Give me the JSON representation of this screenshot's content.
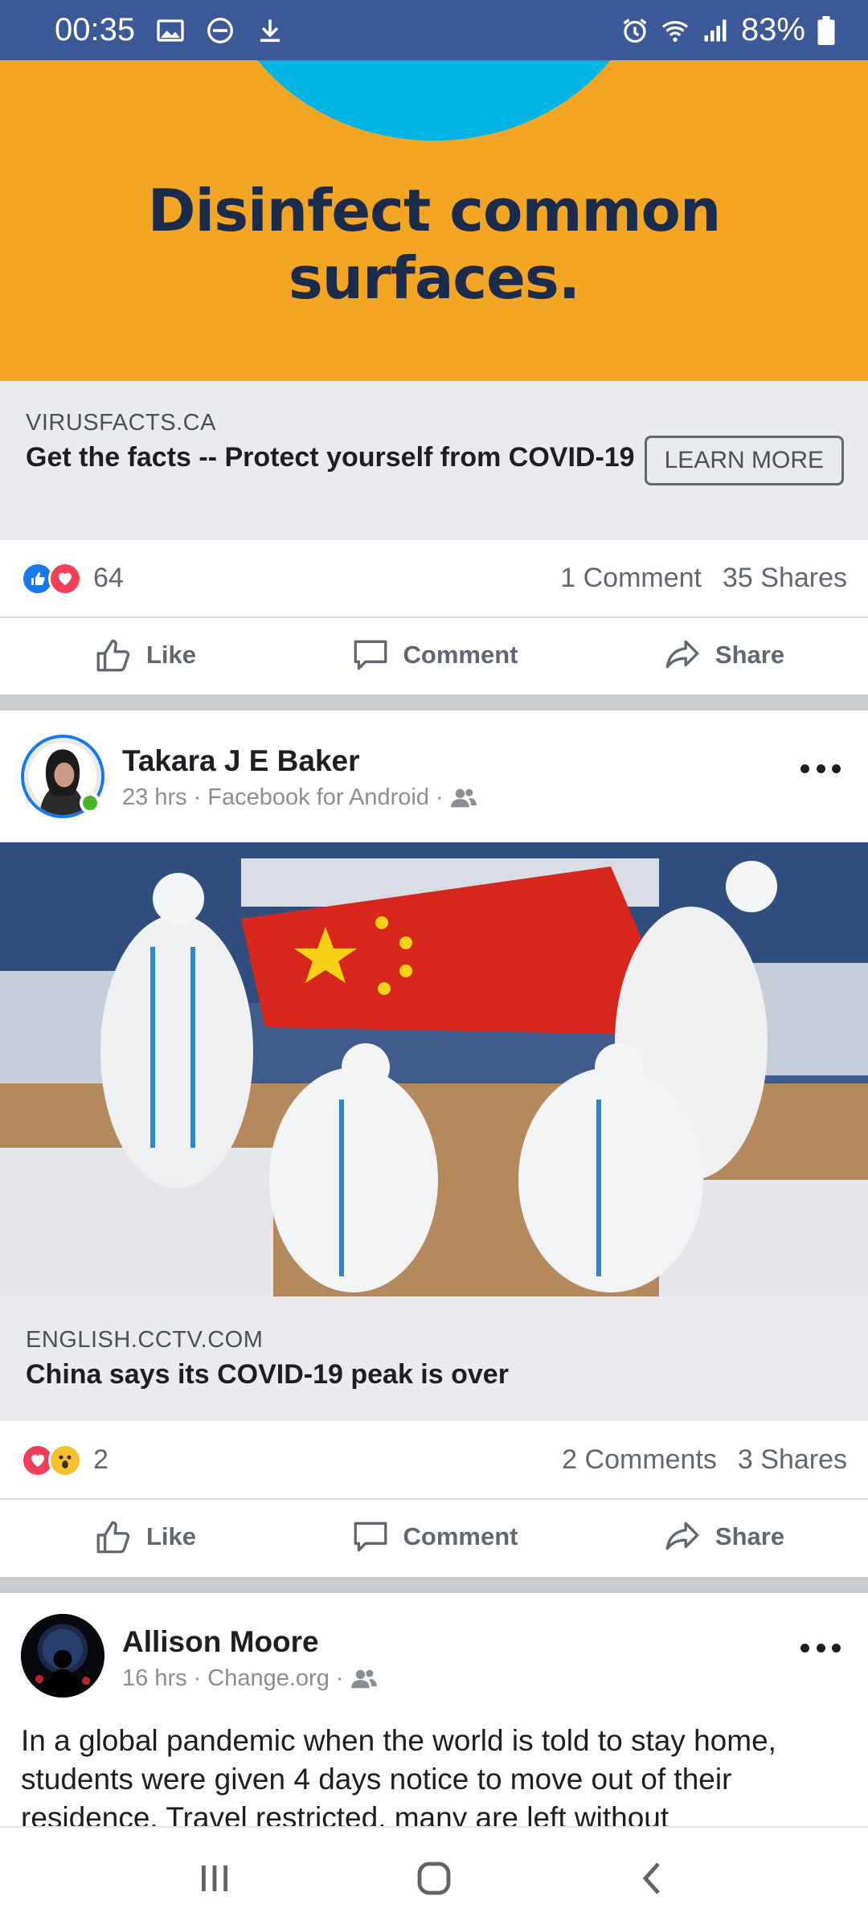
{
  "status_bar": {
    "time": "00:35",
    "battery": "83%",
    "icons_left": [
      "image-icon",
      "dnd-icon",
      "download-icon"
    ],
    "icons_right": [
      "alarm-icon",
      "wifi-icon",
      "signal-icon",
      "battery-icon"
    ],
    "background": "#3b5897"
  },
  "ad_post": {
    "headline": "Disinfect common\nsurfaces.",
    "image_colors": {
      "background": "#f2a623",
      "circle": "#00b4e4",
      "text": "#1b2b4b"
    },
    "domain": "VIRUSFACTS.CA",
    "title": "Get the facts -- Protect yourself from COVID-19",
    "cta_label": "LEARN MORE",
    "reaction_icons": [
      "like-reaction-icon",
      "love-reaction-icon"
    ],
    "reaction_count": "64",
    "comments": "1 Comment",
    "shares": "35 Shares"
  },
  "actions": {
    "like": "Like",
    "comment": "Comment",
    "share": "Share"
  },
  "post1": {
    "author": "Takara J E Baker",
    "time": "23 hrs",
    "source": "Facebook for Android",
    "audience_icon": "friends-icon",
    "link_domain": "ENGLISH.CCTV.COM",
    "link_title": "China says its COVID-19 peak is over",
    "reaction_icons": [
      "love-reaction-icon",
      "wow-reaction-icon"
    ],
    "reaction_count": "2",
    "comments": "2 Comments",
    "shares": "3 Shares"
  },
  "post2": {
    "author": "Allison Moore",
    "time": "16 hrs",
    "source": "Change.org",
    "audience_icon": "friends-icon",
    "text": "In a global pandemic when the world is told to stay home, students were given 4 days notice to move out of their residence. Travel restricted, many are left without"
  },
  "nav": {
    "buttons": [
      "recents-button",
      "home-button",
      "back-button"
    ]
  },
  "colors": {
    "facebook_blue": "#3b5897",
    "like_blue": "#1877f2",
    "love_red": "#f33e58",
    "divider": "#c9ccd1"
  }
}
